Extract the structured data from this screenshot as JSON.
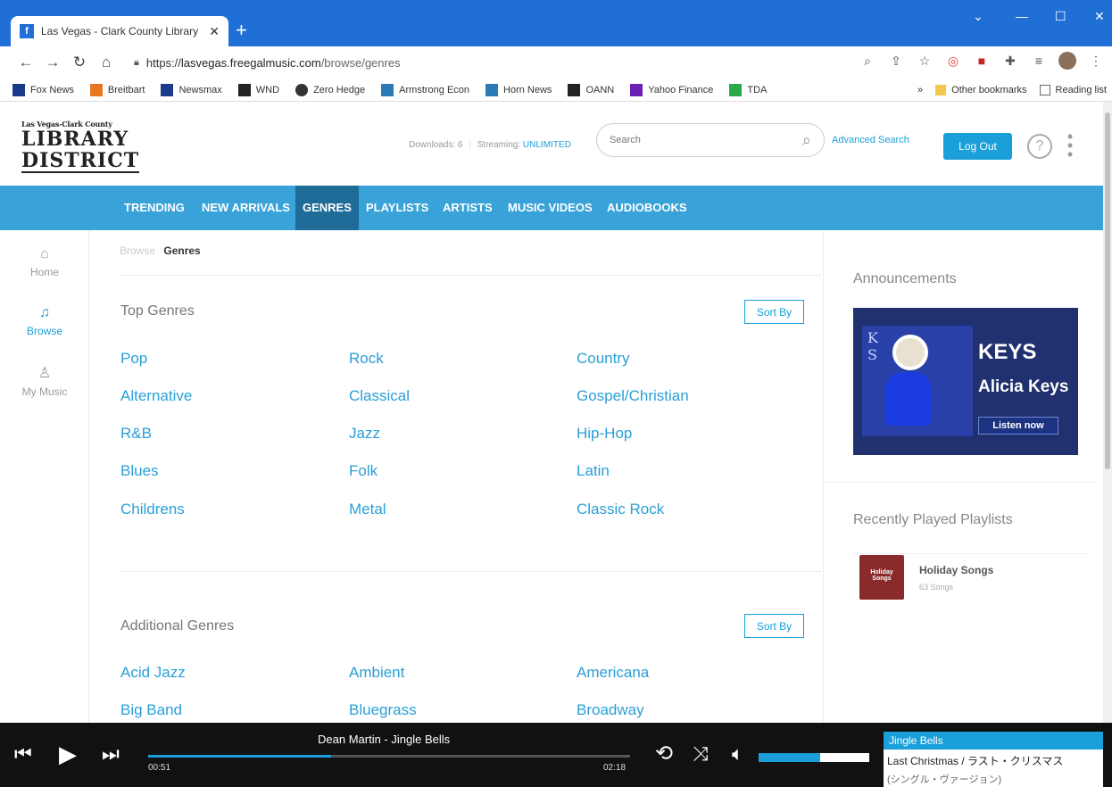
{
  "browser": {
    "tab_title": "Las Vegas - Clark County Library",
    "tab_close": "✕",
    "new_tab": "+",
    "url_prefix": "https://",
    "url_host": "lasvegas.freegalmusic.com",
    "url_path": "/browse/genres",
    "bookmarks": [
      "Fox News",
      "Breitbart",
      "Newsmax",
      "WND",
      "Zero Hedge",
      "Armstrong Econ",
      "Horn News",
      "OANN",
      "Yahoo Finance",
      "TDA"
    ],
    "bookmark_colors": [
      "#1a3a8a",
      "#e87722",
      "#1a3a8a",
      "#222222",
      "#333333",
      "#2a7ab8",
      "#2a7ab8",
      "#222222",
      "#6a1fb5",
      "#2aa84a"
    ],
    "overflow": "»",
    "other_bookmarks": "Other bookmarks",
    "reading_list": "Reading list"
  },
  "header": {
    "logo_small": "Las Vegas-Clark County",
    "logo_line1": "LIBRARY",
    "logo_line2": "DISTRICT",
    "downloads": "Downloads: 6",
    "streaming_label": "Streaming:",
    "streaming_value": "UNLIMITED",
    "search_placeholder": "Search",
    "advanced_search": "Advanced Search",
    "logout": "Log Out",
    "help": "?"
  },
  "nav": {
    "items": [
      "TRENDING",
      "NEW ARRIVALS",
      "GENRES",
      "PLAYLISTS",
      "ARTISTS",
      "MUSIC VIDEOS",
      "AUDIOBOOKS"
    ],
    "active": "GENRES"
  },
  "rail": {
    "home": "Home",
    "browse": "Browse",
    "my_music": "My Music"
  },
  "main": {
    "breadcrumb_root": "Browse",
    "breadcrumb_current": "Genres",
    "top_genres_title": "Top Genres",
    "sort_by": "Sort By",
    "top_genres": [
      "Pop",
      "Rock",
      "Country",
      "Alternative",
      "Classical",
      "Gospel/Christian",
      "R&B",
      "Jazz",
      "Hip-Hop",
      "Blues",
      "Folk",
      "Latin",
      "Childrens",
      "Metal",
      "Classic Rock"
    ],
    "additional_genres_title": "Additional Genres",
    "additional_genres": [
      "Acid Jazz",
      "Ambient",
      "Americana",
      "Big Band",
      "Bluegrass",
      "Broadway"
    ]
  },
  "right": {
    "announcements": "Announcements",
    "ad_title": "KEYS",
    "ad_artist": "Alicia Keys",
    "ad_button": "Listen now",
    "recently_played": "Recently Played Playlists",
    "playlist_name": "Holiday Songs",
    "playlist_count": "63 Songs",
    "playlist_thumb_text": "Holiday Songs"
  },
  "player": {
    "track": "Dean Martin - Jingle Bells",
    "elapsed": "00:51",
    "duration": "02:18",
    "progress": 0.38,
    "volume": 0.56,
    "queue_current": "Jingle Bells",
    "queue_next": "Last Christmas / ラスト・クリスマス",
    "queue_next2": "(シングル・ヴァージョン)"
  },
  "colors": {
    "accent": "#1a9fd8",
    "nav_bg": "#39a3d9",
    "nav_active": "#1f6c98"
  }
}
